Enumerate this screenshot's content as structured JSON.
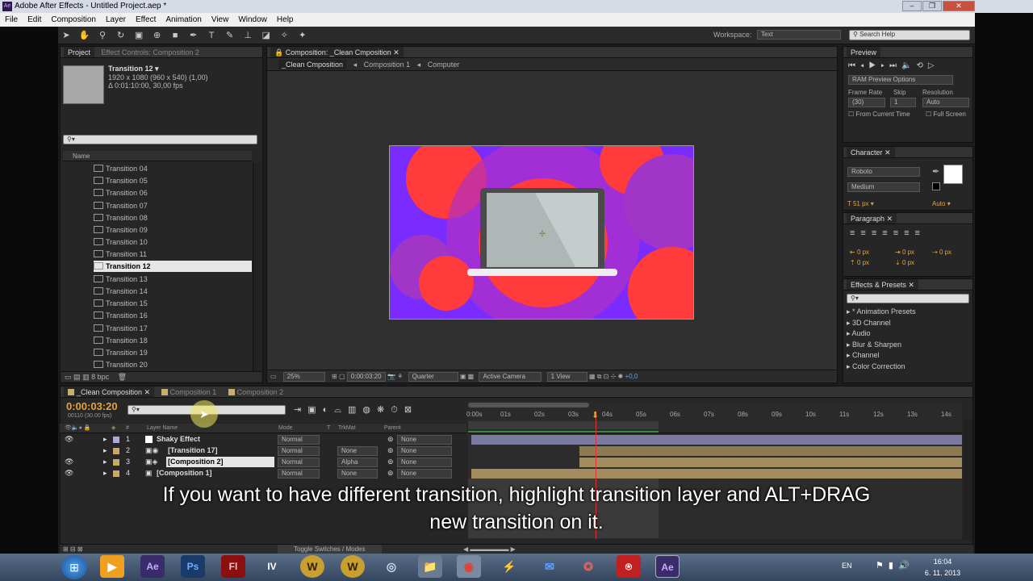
{
  "window": {
    "title": "Adobe After Effects - Untitled Project.aep *",
    "buttons": [
      "–",
      "❐",
      "✕"
    ]
  },
  "menu": [
    "File",
    "Edit",
    "Composition",
    "Layer",
    "Effect",
    "Animation",
    "View",
    "Window",
    "Help"
  ],
  "toolbar": {
    "workspace_label": "Workspace:",
    "workspace_value": "Text",
    "search_help": "Search Help"
  },
  "project": {
    "tabs": [
      "Project",
      "Effect Controls: Composition 2"
    ],
    "selected_name": "Transition 12 ▾",
    "selected_info1": "1920 x 1080  (960 x 540) (1,00)",
    "selected_info2": "Δ 0:01:10:00, 30,00 fps",
    "column_name": "Name",
    "items": [
      "Transition 04",
      "Transition 05",
      "Transition 06",
      "Transition 07",
      "Transition 08",
      "Transition 09",
      "Transition 10",
      "Transition 11",
      "Transition 12",
      "Transition 13",
      "Transition 14",
      "Transition 15",
      "Transition 16",
      "Transition 17",
      "Transition 18",
      "Transition 19",
      "Transition 20"
    ],
    "bpc": "8 bpc"
  },
  "composition": {
    "tab": "Composition: _Clean Cmposition",
    "breadcrumbs": [
      "_Clean Cmposition",
      "Composition 1",
      "Computer"
    ],
    "zoom": "25%",
    "timecode": "0:00:03:20",
    "resolution": "Quarter",
    "camera": "Active Camera",
    "view": "1 View",
    "exposure": "+0,0"
  },
  "preview": {
    "tab": "Preview",
    "ram_options": "RAM Preview Options",
    "frame_rate_label": "Frame Rate",
    "skip_label": "Skip",
    "resolution_label": "Resolution",
    "frame_rate": "(30)",
    "skip": "1",
    "resolution": "Auto",
    "from_current": "From Current Time",
    "full_screen": "Full Screen"
  },
  "character": {
    "tab": "Character",
    "font": "Roboto",
    "style": "Medium",
    "size": "51 px",
    "leading": "Auto"
  },
  "paragraph": {
    "tab": "Paragraph",
    "values": [
      "0 px",
      "0 px",
      "0 px",
      "0 px",
      "0 px"
    ]
  },
  "effects": {
    "tab": "Effects & Presets",
    "items": [
      "* Animation Presets",
      "3D Channel",
      "Audio",
      "Blur & Sharpen",
      "Channel",
      "Color Correction"
    ]
  },
  "timeline": {
    "tabs": [
      "_Clean Composition",
      "Composition 1",
      "Composition 2"
    ],
    "timecode": "0:00:03:20",
    "frames": "00110 (30.00 fps)",
    "headers": {
      "layer_name": "Layer Name",
      "mode": "Mode",
      "t": "T",
      "trkmat": "TrkMat",
      "parent": "Parent"
    },
    "ruler": [
      "0:00s",
      "01s",
      "02s",
      "03s",
      "04s",
      "05s",
      "06s",
      "07s",
      "08s",
      "09s",
      "10s",
      "11s",
      "12s",
      "13s",
      "14s"
    ],
    "layers": [
      {
        "num": "1",
        "name": "Shaky Effect",
        "mode": "Normal",
        "trkmat": "",
        "parent": "None"
      },
      {
        "num": "2",
        "name": "[Transition 17]",
        "mode": "Normal",
        "trkmat": "None",
        "parent": "None"
      },
      {
        "num": "3",
        "name": "[Composition 2]",
        "mode": "Normal",
        "trkmat": "Alpha",
        "parent": "None"
      },
      {
        "num": "4",
        "name": "[Composition 1]",
        "mode": "Normal",
        "trkmat": "None",
        "parent": "None"
      }
    ],
    "toggle": "Toggle Switches / Modes"
  },
  "subtitle": {
    "line1": "If you want to have different transition, highlight transition layer and ALT+DRAG",
    "line2": "new transition on it."
  },
  "taskbar": {
    "apps": [
      "Ae",
      "Ps",
      "Fl",
      "IV",
      "W",
      "W",
      "Ae"
    ],
    "lang": "EN",
    "time": "16:04",
    "date": "6. 11. 2013"
  },
  "colors": {
    "accent_orange": "#e8a23a",
    "playhead": "#e03030",
    "comp_purple": "#7a2cff",
    "comp_red": "#ff3b3b"
  }
}
